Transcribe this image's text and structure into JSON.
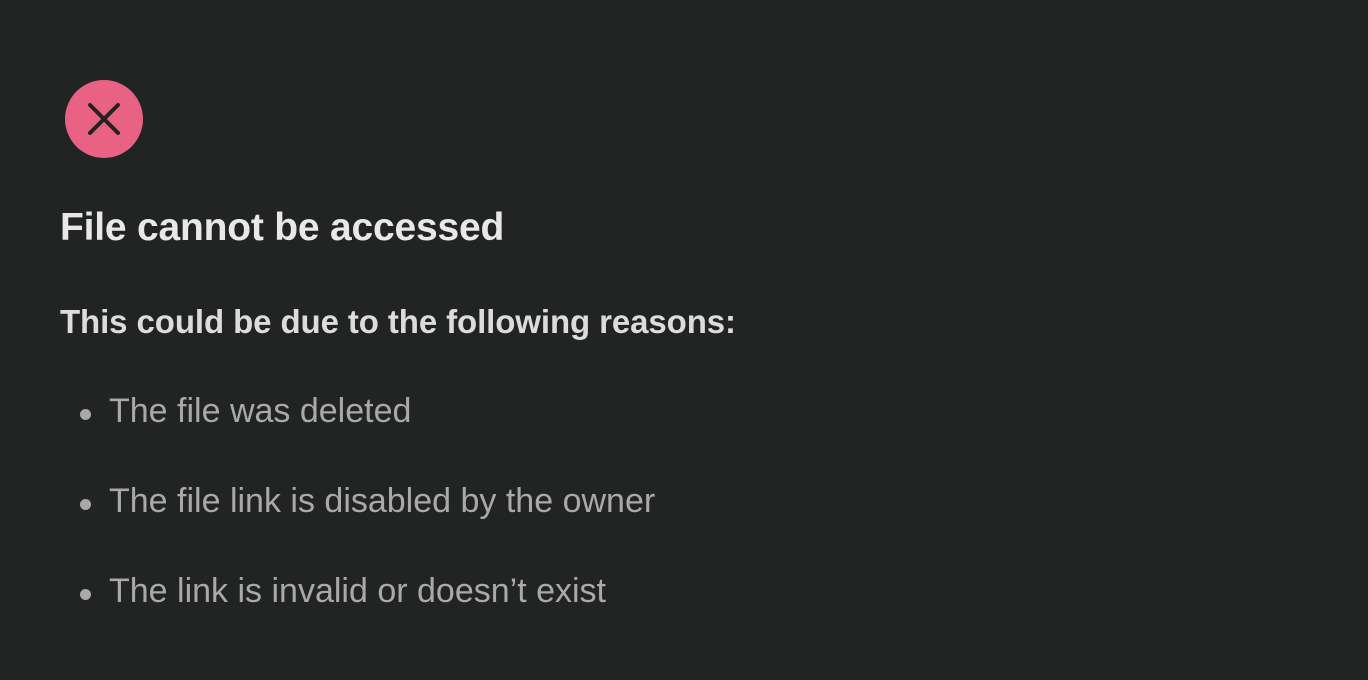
{
  "icon": {
    "name": "close-icon",
    "background": "#ea6283",
    "glyph_color": "#222323"
  },
  "title": "File cannot be accessed",
  "subtitle": "This could be due to the following reasons:",
  "reasons": [
    "The file was deleted",
    "The file link is disabled by the owner",
    "The link is invalid or doesn’t exist"
  ],
  "colors": {
    "background": "#222323",
    "title": "#e8e8e8",
    "subtitle": "#dcdcdc",
    "reason_text": "#a9a9a9"
  }
}
